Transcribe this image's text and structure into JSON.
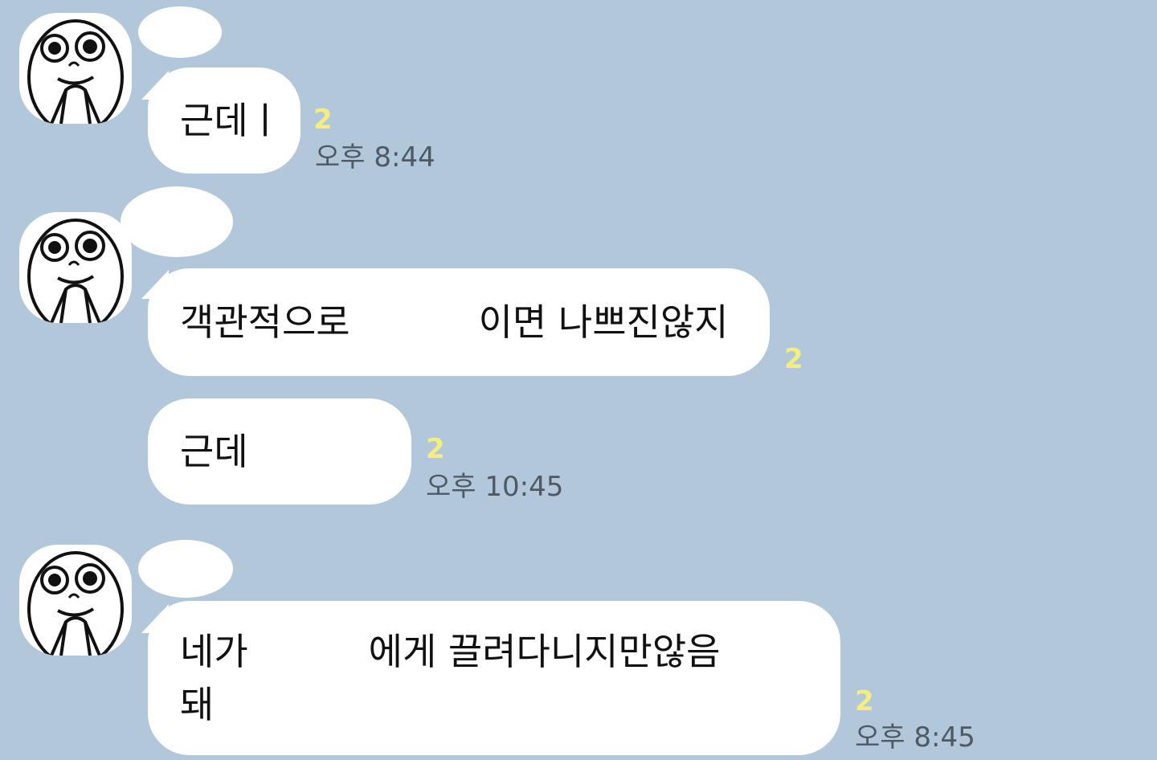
{
  "chat": {
    "background_color": "#b2c7da",
    "messages": [
      {
        "text": "근데ㅣ",
        "unread": "2",
        "time": "오후 8:44"
      },
      {
        "text_before": "객관적으로",
        "text_after": "이면 나쁘진않지",
        "unread": "2"
      },
      {
        "text": "근데",
        "unread": "2",
        "time": "오후 10:45"
      },
      {
        "line1_before": "네가",
        "line1_after": "에게 끌려다니지만않음",
        "line2": "돼",
        "unread": "2",
        "time": "오후 8:45"
      }
    ]
  }
}
